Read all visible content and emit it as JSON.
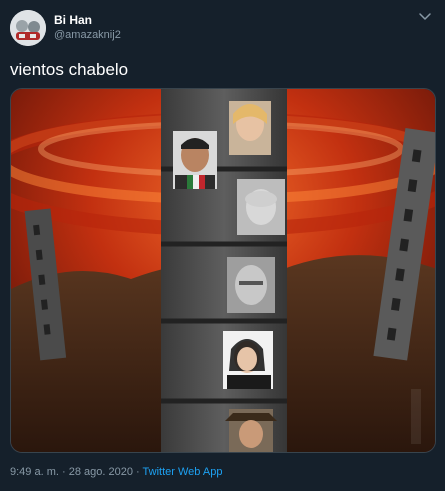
{
  "author": {
    "name": "Bi Han",
    "handle": "@amazaknij2"
  },
  "tweet": {
    "text": "vientos chabelo",
    "time": "9:49 a. m.",
    "separator": "·",
    "date": "28 ago. 2020",
    "app": "Twitter Web App"
  },
  "icons": {
    "more": "chevron-down-icon",
    "avatar": "avatar"
  },
  "colors": {
    "background": "#15202b",
    "text": "#ffffff",
    "secondary": "#8899a6",
    "link": "#1da1f2",
    "border": "#38444d"
  }
}
